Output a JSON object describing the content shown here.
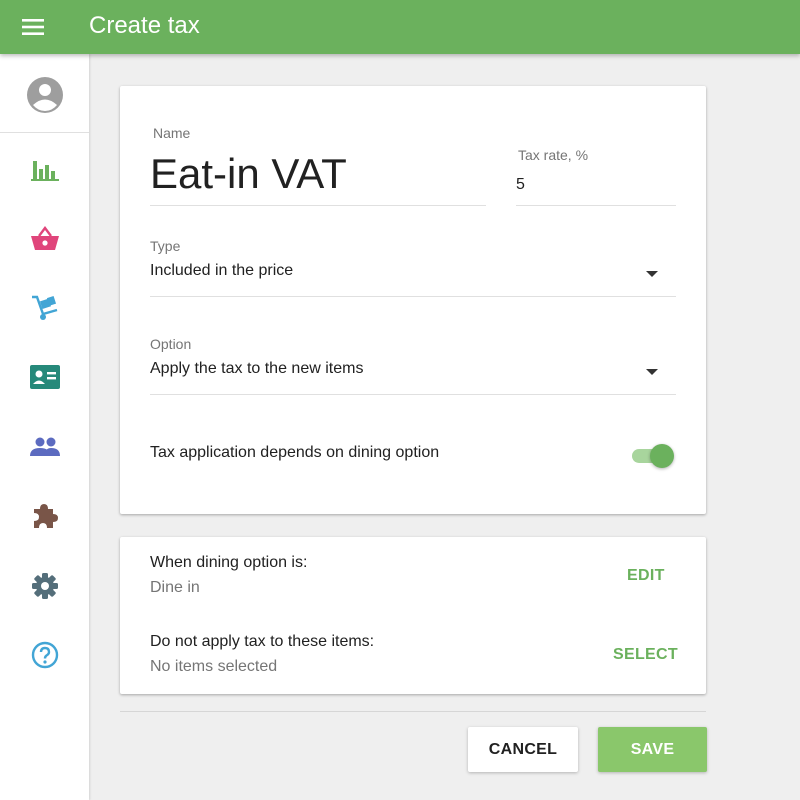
{
  "appbar": {
    "title": "Create tax",
    "menu_icon": "menu-icon",
    "color": "#6bb15d"
  },
  "sidebar": {
    "items": [
      {
        "icon": "account-circle-icon",
        "color": "#9e9e9e"
      },
      {
        "icon": "bar-chart-icon",
        "color": "#6bb15d"
      },
      {
        "icon": "shopping-basket-icon",
        "color": "#e0457b"
      },
      {
        "icon": "hand-truck-icon",
        "color": "#42a5d5"
      },
      {
        "icon": "contact-card-icon",
        "color": "#26897a"
      },
      {
        "icon": "people-icon",
        "color": "#5c6bc0"
      },
      {
        "icon": "puzzle-icon",
        "color": "#795548"
      },
      {
        "icon": "gear-icon",
        "color": "#546e7a"
      },
      {
        "icon": "help-icon",
        "color": "#42a5d5"
      }
    ]
  },
  "form": {
    "name_label": "Name",
    "name_value": "Eat-in VAT",
    "rate_label": "Tax rate, %",
    "rate_value": "5",
    "type_label": "Type",
    "type_value": "Included in the price",
    "option_label": "Option",
    "option_value": "Apply the tax to the new items",
    "toggle_label": "Tax application depends on dining option",
    "toggle_on": true
  },
  "dining": {
    "title": "When dining option is:",
    "value": "Dine in",
    "edit_label": "EDIT",
    "items_title": "Do not apply tax to these items:",
    "items_value": "No items selected",
    "select_label": "SELECT"
  },
  "actions": {
    "cancel_label": "CANCEL",
    "save_label": "SAVE",
    "save_color": "#8ac76b"
  }
}
